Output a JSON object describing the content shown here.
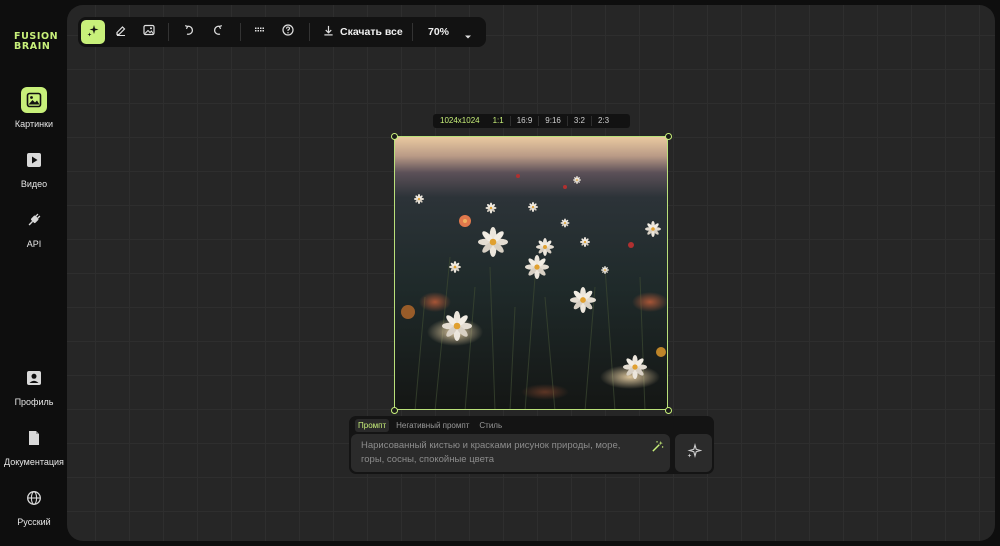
{
  "brand": {
    "line1": "FUSION",
    "line2": "BRAIN",
    "color": "#c8f07a"
  },
  "sidebar": {
    "top_items": [
      {
        "label": "Картинки",
        "icon": "image-icon",
        "active": true
      },
      {
        "label": "Видео",
        "icon": "video-icon",
        "active": false
      },
      {
        "label": "API",
        "icon": "plug-icon",
        "active": false
      }
    ],
    "bottom_items": [
      {
        "label": "Профиль",
        "icon": "profile-icon"
      },
      {
        "label": "Документация",
        "icon": "document-icon"
      },
      {
        "label": "Русский",
        "icon": "globe-icon"
      }
    ]
  },
  "toolbar": {
    "tools": [
      "generate-tool-icon",
      "eraser-icon",
      "image-upload-icon",
      "undo-icon",
      "redo-icon",
      "keyboard-icon",
      "help-icon"
    ],
    "download_label": "Скачать все",
    "zoom": "70%"
  },
  "ratio_bar": {
    "size": "1024x1024",
    "options": [
      "1:1",
      "16:9",
      "9:16",
      "3:2",
      "2:3"
    ],
    "selected": "1:1"
  },
  "prompt": {
    "tabs": [
      "Промпт",
      "Негативный промпт",
      "Стиль"
    ],
    "active_tab": "Промпт",
    "placeholder": "Нарисованный кистью и красками рисунок природы, море, горы, сосны, спокойные цвета"
  },
  "colors": {
    "accent": "#c8f07a",
    "canvas": "#262626",
    "panel": "#121212"
  }
}
